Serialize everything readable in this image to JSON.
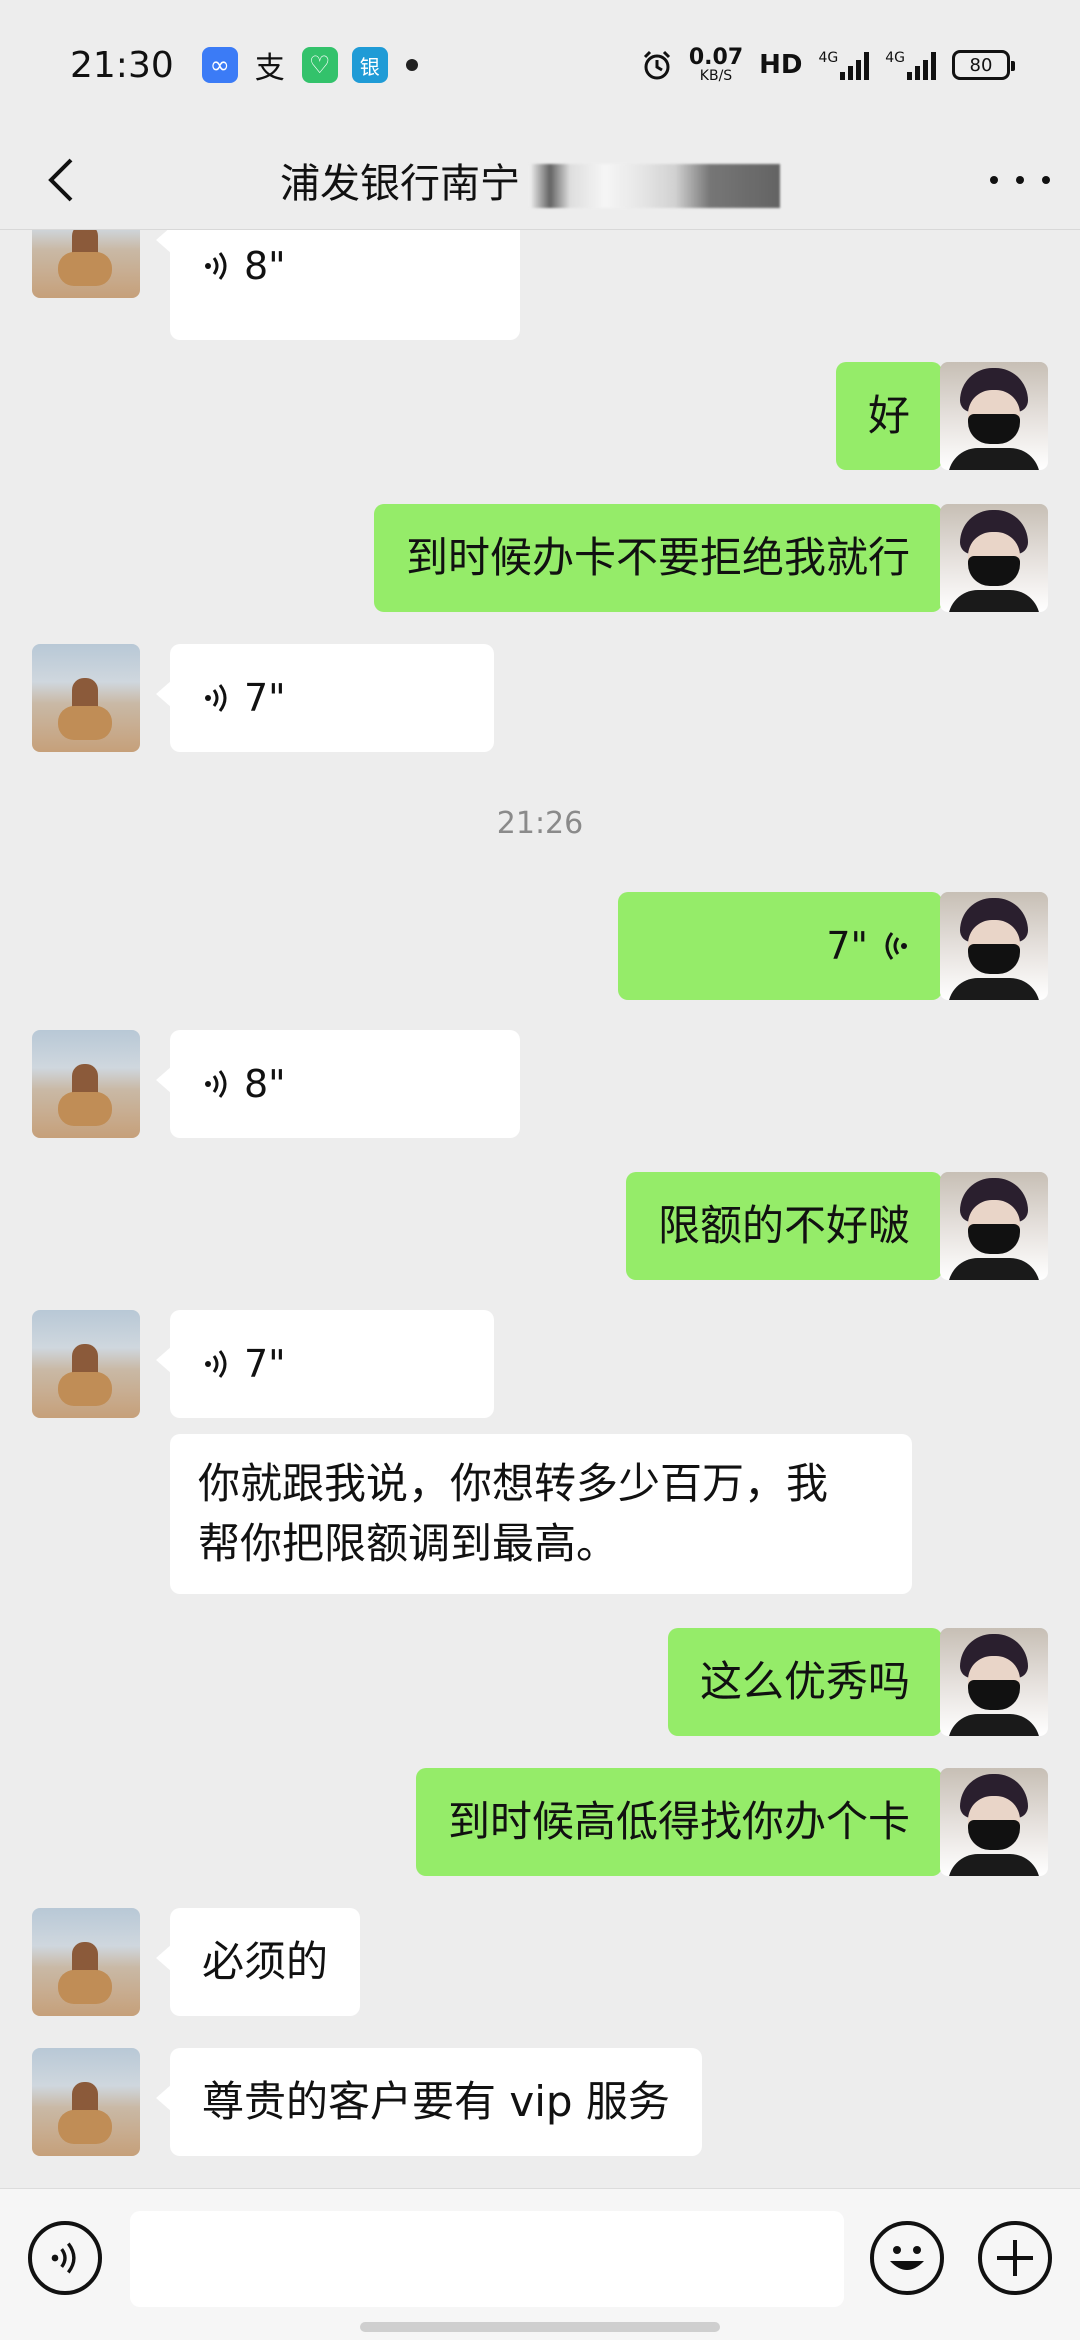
{
  "status_bar": {
    "time": "21:30",
    "apps": [
      {
        "icon": "infinity-app-icon",
        "glyph": "∞",
        "color": "#3b7bf6"
      },
      {
        "icon": "alipay-icon",
        "glyph": "支",
        "color": "#ffffff"
      },
      {
        "icon": "green-app-icon",
        "glyph": "♡",
        "color": "#33c26b"
      },
      {
        "icon": "bank-app-icon",
        "glyph": "银",
        "color": "#1f9bd6"
      }
    ],
    "net_speed": "0.07",
    "net_unit": "KB/S",
    "hd_label": "HD",
    "network_1": "4G",
    "network_2": "4G",
    "battery": "80"
  },
  "header": {
    "title": "浦发银行南宁"
  },
  "messages": [
    {
      "side": "left",
      "type": "voice",
      "duration": "8\""
    },
    {
      "side": "right",
      "type": "text",
      "text": "好"
    },
    {
      "side": "right",
      "type": "text",
      "text": "到时候办卡不要拒绝我就行"
    },
    {
      "side": "left",
      "type": "voice",
      "duration": "7\""
    },
    {
      "type": "time",
      "text": "21:26"
    },
    {
      "side": "right",
      "type": "voice",
      "duration": "7\""
    },
    {
      "side": "left",
      "type": "voice",
      "duration": "8\""
    },
    {
      "side": "right",
      "type": "text",
      "text": "限额的不好啵"
    },
    {
      "side": "left",
      "type": "voice",
      "duration": "7\""
    },
    {
      "side": "left",
      "type": "text",
      "line1": "你就跟我说，你想转多少百万，我",
      "line2": "帮你把限额调到最高。"
    },
    {
      "side": "right",
      "type": "text",
      "text": "这么优秀吗"
    },
    {
      "side": "right",
      "type": "text",
      "text": "到时候高低得找你办个卡"
    },
    {
      "side": "left",
      "type": "text",
      "text": "必须的"
    },
    {
      "side": "left",
      "type": "text",
      "text": "尊贵的客户要有 vip 服务"
    }
  ],
  "colors": {
    "background": "#ededed",
    "self_bubble": "#95ec69",
    "other_bubble": "#ffffff"
  }
}
